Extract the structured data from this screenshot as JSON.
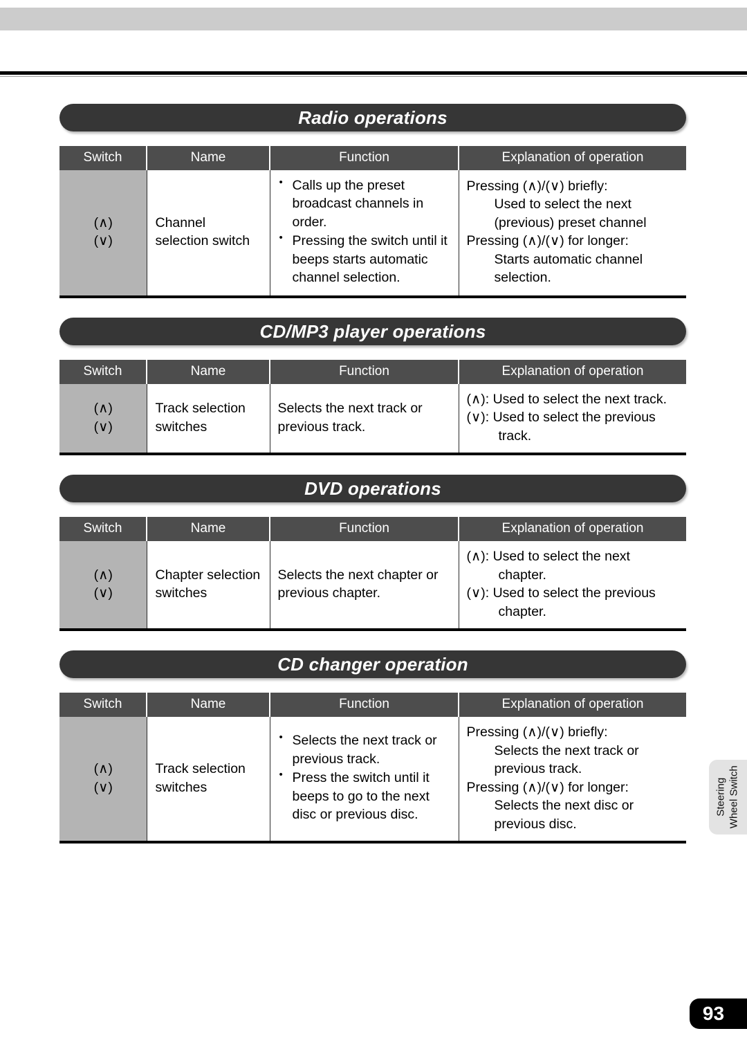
{
  "page": {
    "number": "93",
    "side_tab": {
      "line1": "Steering",
      "line2": "Wheel Switch"
    }
  },
  "table_headers": {
    "switch": "Switch",
    "name": "Name",
    "function": "Function",
    "explanation": "Explanation of operation"
  },
  "sections": [
    {
      "title": "Radio operations",
      "row": {
        "switch": "(∧)\n(∨)",
        "name": "Channel\nselection switch",
        "function_bullets": [
          "Calls up the preset broadcast channels in order.",
          "Pressing the switch until it beeps starts automatic channel selection."
        ],
        "explanation_blocks": [
          {
            "head": "Pressing (∧)/(∨) briefly:",
            "body": "Used to select the next (previous) preset channel"
          },
          {
            "head": "Pressing (∧)/(∨) for longer:",
            "body": "Starts automatic channel selection."
          }
        ]
      }
    },
    {
      "title": "CD/MP3 player operations",
      "row": {
        "switch": "(∧)\n(∨)",
        "name": "Track selection\nswitches",
        "function_text": "Selects the next track or previous track.",
        "explanation_defs": [
          "(∧): Used to select the next track.",
          "(∨): Used to select the previous track."
        ]
      }
    },
    {
      "title": "DVD operations",
      "row": {
        "switch": "(∧)\n(∨)",
        "name": "Chapter selection\nswitches",
        "function_text": "Selects the next chapter or previous chapter.",
        "explanation_defs": [
          "(∧): Used to select the next chapter.",
          "(∨): Used to select the previous chapter."
        ]
      }
    },
    {
      "title": "CD changer operation",
      "row": {
        "switch": "(∧)\n(∨)",
        "name": "Track selection\nswitches",
        "function_bullets": [
          "Selects the next track or previous track.",
          "Press the switch until it beeps to go to the next disc or previous disc."
        ],
        "explanation_blocks": [
          {
            "head": "Pressing (∧)/(∨) briefly:",
            "body": "Selects the next track or previous track."
          },
          {
            "head": "Pressing (∧)/(∨) for longer:",
            "body": "Selects the next disc or previous disc."
          }
        ]
      }
    }
  ]
}
